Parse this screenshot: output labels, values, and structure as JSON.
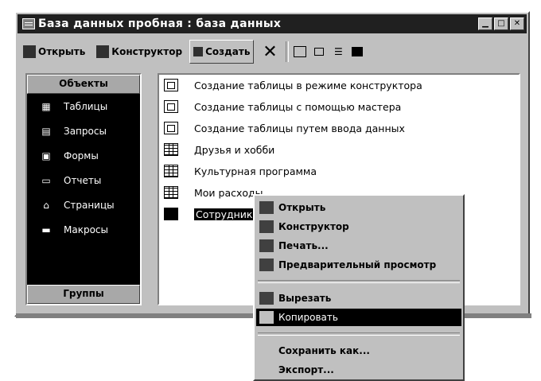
{
  "window": {
    "title": "База данных пробная : база данных",
    "buttons": [
      "minimize-icon",
      "maximize-icon",
      "close-icon"
    ]
  },
  "toolbar": {
    "open_label": "Открыть",
    "design_label": "Конструктор",
    "create_label": "Создать",
    "delete_symbol": "✕"
  },
  "sidebar": {
    "header": "Объекты",
    "footer": "Группы",
    "items": [
      {
        "label": "Таблицы",
        "icon": "table-icon"
      },
      {
        "label": "Запросы",
        "icon": "query-icon"
      },
      {
        "label": "Формы",
        "icon": "form-icon"
      },
      {
        "label": "Отчеты",
        "icon": "report-icon"
      },
      {
        "label": "Страницы",
        "icon": "page-icon"
      },
      {
        "label": "Макросы",
        "icon": "macro-icon"
      }
    ]
  },
  "objects": [
    {
      "label": "Создание таблицы в режиме конструктора",
      "icon": "wizard-icon"
    },
    {
      "label": "Создание таблицы с помощью мастера",
      "icon": "wizard-icon"
    },
    {
      "label": "Создание таблицы путем ввода данных",
      "icon": "wizard-icon"
    },
    {
      "label": "Друзья и хобби",
      "icon": "table-icon"
    },
    {
      "label": "Культурная программа",
      "icon": "table-icon"
    },
    {
      "label": "Мои расходы",
      "icon": "table-icon"
    },
    {
      "label": "Сотрудники",
      "icon": "table-icon"
    }
  ],
  "context_menu": {
    "items": [
      {
        "label": "Открыть",
        "icon": "open-icon"
      },
      {
        "label": "Конструктор",
        "icon": "design-icon"
      },
      {
        "label": "Печать...",
        "icon": "print-icon"
      },
      {
        "label": "Предварительный просмотр",
        "icon": "preview-icon"
      },
      {
        "label": "Вырезать",
        "icon": "cut-icon"
      },
      {
        "label": "Копировать",
        "icon": "copy-icon"
      },
      {
        "label": "Сохранить как...",
        "icon": ""
      },
      {
        "label": "Экспорт...",
        "icon": ""
      }
    ]
  }
}
